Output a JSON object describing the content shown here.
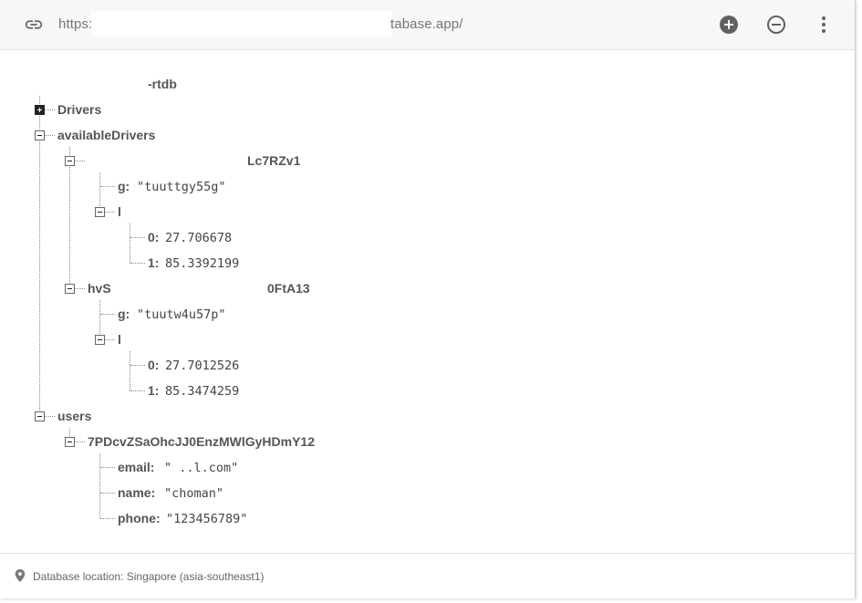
{
  "url_bar": {
    "prefix": "https:",
    "suffix": "tabase.app/"
  },
  "toolbar": {
    "add_icon": "add-circle-icon",
    "remove_icon": "remove-circle-icon",
    "more_icon": "more-vert-icon"
  },
  "tree": {
    "root_label": "-rtdb",
    "nodes": {
      "drivers": "Drivers",
      "available_drivers": "availableDrivers",
      "driver1": {
        "key": "Lc7RZv1",
        "g_key": "g:",
        "g_val": "\"tuuttgy55g\"",
        "l_key": "l",
        "l0_key": "0:",
        "l0_val": "27.706678",
        "l1_key": "1:",
        "l1_val": "85.3392199"
      },
      "driver2": {
        "key_prefix": "hvS",
        "key_suffix": "0FtA13",
        "g_key": "g:",
        "g_val": "\"tuutw4u57p\"",
        "l_key": "l",
        "l0_key": "0:",
        "l0_val": "27.7012526",
        "l1_key": "1:",
        "l1_val": "85.3474259"
      },
      "users": "users",
      "user1": {
        "key": "7PDcvZSaOhcJJ0EnzMWlGyHDmY12",
        "email_key": "email:",
        "email_val": "\"  ..l.com\"",
        "name_key": "name:",
        "name_val": "\"choman\"",
        "phone_key": "phone:",
        "phone_val": "\"123456789\""
      }
    }
  },
  "footer": {
    "location_text": "Database location: Singapore (asia-southeast1)"
  },
  "colors": {
    "accent_dark": "#616161",
    "text": "#555555",
    "muted": "#757575"
  }
}
